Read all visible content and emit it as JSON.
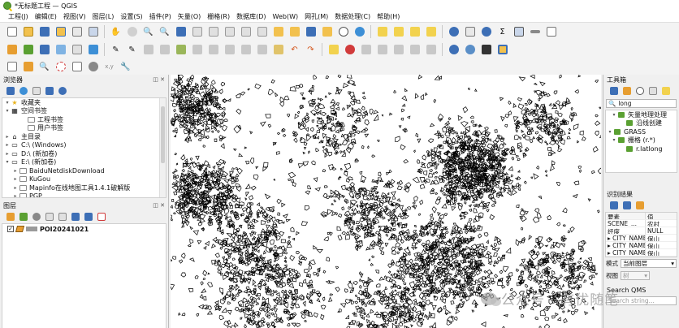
{
  "window": {
    "title": "*无标题工程 — QGIS"
  },
  "menu": [
    "工程(J)",
    "编辑(E)",
    "视图(V)",
    "图层(L)",
    "设置(S)",
    "插件(P)",
    "矢量(O)",
    "栅格(R)",
    "数据库(D)",
    "Web(W)",
    "网孔(M)",
    "数据处理(C)",
    "帮助(H)"
  ],
  "browser": {
    "title": "浏览器",
    "items": [
      {
        "label": "收藏夹",
        "arrow": "▾",
        "indent": 0,
        "icon": "star-icon"
      },
      {
        "label": "空间书签",
        "arrow": "▾",
        "indent": 0,
        "icon": "bookmark-icon"
      },
      {
        "label": "工程书签",
        "arrow": "",
        "indent": 2,
        "icon": "folder-icon"
      },
      {
        "label": "用户书签",
        "arrow": "",
        "indent": 2,
        "icon": "folder-icon"
      },
      {
        "label": "主目录",
        "arrow": "▸",
        "indent": 0,
        "icon": "home-icon"
      },
      {
        "label": "C:\\ (Windows)",
        "arrow": "▸",
        "indent": 0,
        "icon": "drive-icon"
      },
      {
        "label": "D:\\ (新加卷)",
        "arrow": "▸",
        "indent": 0,
        "icon": "drive-icon"
      },
      {
        "label": "E:\\ (新加卷)",
        "arrow": "▾",
        "indent": 0,
        "icon": "drive-icon"
      },
      {
        "label": "BaiduNetdiskDownload",
        "arrow": "▸",
        "indent": 1,
        "icon": "folder-icon"
      },
      {
        "label": "KuGou",
        "arrow": "▸",
        "indent": 1,
        "icon": "folder-icon"
      },
      {
        "label": "Mapinfo在线地图工具1.4.1破解版",
        "arrow": "▸",
        "indent": 1,
        "icon": "folder-icon"
      },
      {
        "label": "PGP",
        "arrow": "▸",
        "indent": 1,
        "icon": "folder-icon"
      }
    ]
  },
  "layers": {
    "title": "图层",
    "items": [
      {
        "label": "POI20241021",
        "checked": true
      }
    ]
  },
  "toolbox": {
    "title": "工具箱",
    "search_value": "long",
    "items": [
      {
        "label": "矢量地理处理",
        "arrow": "▾",
        "indent": 1
      },
      {
        "label": "沿线创建",
        "arrow": "",
        "indent": 3
      },
      {
        "label": "GRASS",
        "arrow": "▾",
        "indent": 0
      },
      {
        "label": "栅格 (r.*)",
        "arrow": "▾",
        "indent": 1
      },
      {
        "label": "r.latlong",
        "arrow": "",
        "indent": 3
      }
    ]
  },
  "identify": {
    "title": "识别结果",
    "header": [
      "要素",
      "值"
    ],
    "rows": [
      {
        "arrow": "",
        "name": "SCENE_...",
        "value": "农村"
      },
      {
        "arrow": "",
        "name": "经度",
        "value": "NULL"
      },
      {
        "arrow": "▸",
        "name": "CITY_NAME",
        "value": "保山"
      },
      {
        "arrow": "▸",
        "name": "CITY_NAME",
        "value": "保山"
      },
      {
        "arrow": "▸",
        "name": "CITY_NAME",
        "value": "保山"
      }
    ],
    "mode_label": "模式",
    "mode_value": "当前图层",
    "view_label": "视图",
    "view_value": "树"
  },
  "qms": {
    "title": "Search QMS",
    "placeholder": "Search string..."
  },
  "watermark": {
    "text": "公众号 · 有优随笔"
  },
  "colors": {
    "accent": "#5aa032",
    "map_bg": "#ffffff",
    "feature_stroke": "#000000"
  }
}
